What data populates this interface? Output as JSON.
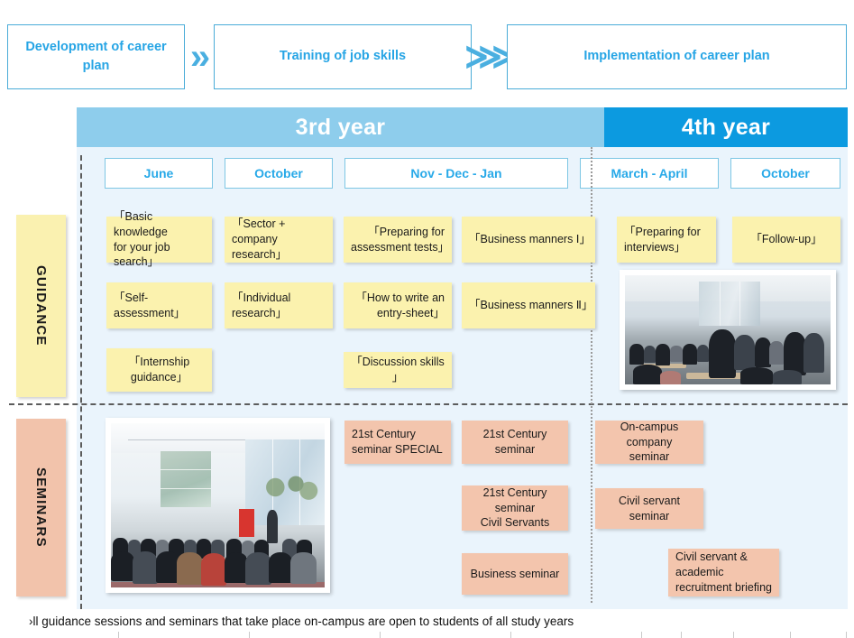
{
  "phases": {
    "steps": [
      {
        "label": "Development of\ncareer plan"
      },
      {
        "label": "Training of job skills"
      },
      {
        "label": "Implementation of career plan"
      }
    ],
    "chevron_1": "»",
    "chevron_2": "⋙"
  },
  "years": [
    {
      "label": "3rd year",
      "color": "#8ecdec"
    },
    {
      "label": "4th year",
      "color": "#0c9ae0"
    }
  ],
  "months": [
    {
      "label": "June"
    },
    {
      "label": "October"
    },
    {
      "label": "Nov - Dec - Jan"
    },
    {
      "label": "March - April"
    },
    {
      "label": "October"
    }
  ],
  "rows": {
    "guidance": {
      "label": "GUIDANCE",
      "color": "#faf1b0"
    },
    "seminars": {
      "label": "SEMINARS",
      "color": "#f2c3ab"
    }
  },
  "guidance_cards": [
    {
      "label": "「Basic knowledge\n for your job search」"
    },
    {
      "label": "「Sector +\ncompany research」"
    },
    {
      "label": "「Preparing for\nassessment tests」"
    },
    {
      "label": "「Business manners Ⅰ」"
    },
    {
      "label": "「Preparing for\ninterviews」"
    },
    {
      "label": "「Follow-up」"
    },
    {
      "label": "「Self-assessment」"
    },
    {
      "label": "「Individual research」"
    },
    {
      "label": "「How to write an\nentry-sheet」"
    },
    {
      "label": "「Business manners Ⅱ」"
    },
    {
      "label": "「Internship\nguidance」"
    },
    {
      "label": "「Discussion skills 」"
    }
  ],
  "seminar_cards": [
    {
      "label": "21st Century\nseminar SPECIAL"
    },
    {
      "label": "21st Century seminar"
    },
    {
      "label": "On-campus company\nseminar"
    },
    {
      "label": "21st Century\nseminar\nCivil Servants"
    },
    {
      "label": "Civil servant seminar"
    },
    {
      "label": "Business seminar"
    },
    {
      "label": "Civil servant &\nacademic\nrecruitment briefing"
    }
  ],
  "photos": {
    "job_fair": {
      "caption": "students at on-campus job fair"
    },
    "seminar_room": {
      "caption": "audience seated at campus seminar"
    }
  },
  "footnote": "›ll guidance sessions and seminars that take place on-campus are open to students of all study years"
}
